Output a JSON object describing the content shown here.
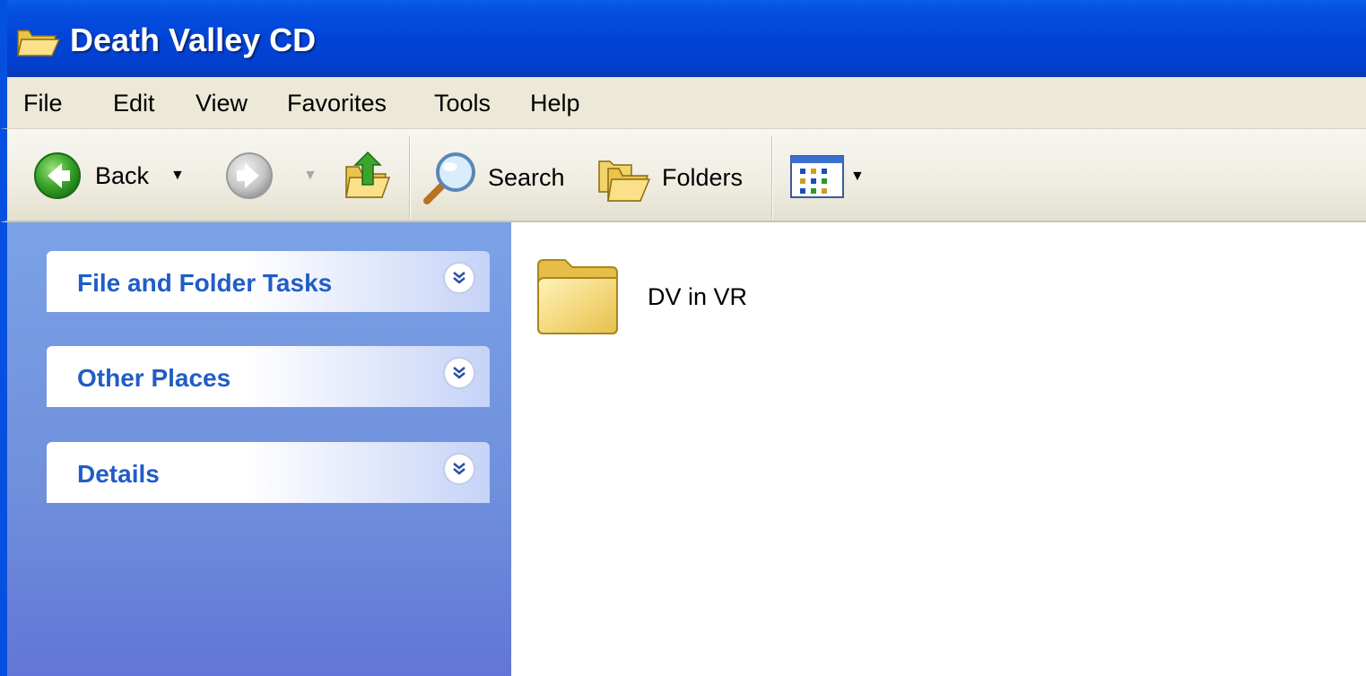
{
  "window": {
    "title": "Death Valley CD",
    "icon": "folder-open-icon"
  },
  "menubar": {
    "items": [
      "File",
      "Edit",
      "View",
      "Favorites",
      "Tools",
      "Help"
    ]
  },
  "toolbar": {
    "back_label": "Back",
    "search_label": "Search",
    "folders_label": "Folders",
    "icons": [
      "back-arrow-icon",
      "forward-arrow-icon",
      "up-folder-icon",
      "search-magnifier-icon",
      "folders-icon",
      "views-icon"
    ]
  },
  "taskpane": {
    "groups": [
      {
        "title": "File and Folder Tasks",
        "icon": "chevron-double-down-icon"
      },
      {
        "title": "Other Places",
        "icon": "chevron-double-down-icon"
      },
      {
        "title": "Details",
        "icon": "chevron-double-down-icon"
      }
    ]
  },
  "content": {
    "items": [
      {
        "name": "DV in VR",
        "icon": "folder-icon"
      }
    ]
  },
  "colors": {
    "titlebar": "#0243d6",
    "taskpane": "#6f8fdc",
    "group_title": "#215dc6",
    "menubar": "#ece9d8"
  }
}
